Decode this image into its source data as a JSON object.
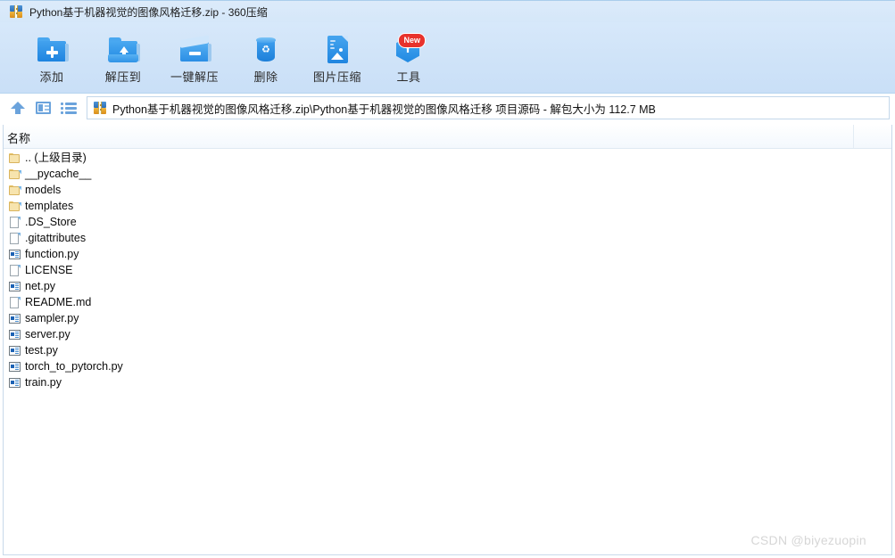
{
  "window": {
    "title": "Python基于机器视觉的图像风格迁移.zip - 360压缩",
    "app_icon": "zip-archive-icon"
  },
  "toolbar": {
    "buttons": [
      {
        "label": "添加",
        "icon": "folder-add-icon"
      },
      {
        "label": "解压到",
        "icon": "folder-extract-icon"
      },
      {
        "label": "一键解压",
        "icon": "folder-oneclick-extract-icon"
      },
      {
        "label": "删除",
        "icon": "recycle-bin-icon"
      },
      {
        "label": "图片压缩",
        "icon": "image-compress-icon"
      },
      {
        "label": "工具",
        "icon": "tools-hexagon-icon",
        "badge": "New"
      }
    ]
  },
  "addressbar": {
    "up_icon": "arrow-up-icon",
    "panel_icon": "preview-panel-icon",
    "list_icon": "list-view-icon",
    "path_icon": "zip-archive-icon",
    "path": "Python基于机器视觉的图像风格迁移.zip\\Python基于机器视觉的图像风格迁移 项目源码 - 解包大小为 112.7 MB"
  },
  "filelist": {
    "columns": [
      "名称"
    ],
    "rows": [
      {
        "name": ".. (上级目录)",
        "icon": "folder-plain-icon"
      },
      {
        "name": "__pycache__",
        "icon": "folder-icon"
      },
      {
        "name": "models",
        "icon": "folder-icon"
      },
      {
        "name": "templates",
        "icon": "folder-icon"
      },
      {
        "name": ".DS_Store",
        "icon": "file-icon"
      },
      {
        "name": ".gitattributes",
        "icon": "file-icon"
      },
      {
        "name": "function.py",
        "icon": "python-file-icon"
      },
      {
        "name": "LICENSE",
        "icon": "file-icon"
      },
      {
        "name": "net.py",
        "icon": "python-file-icon"
      },
      {
        "name": "README.md",
        "icon": "file-icon"
      },
      {
        "name": "sampler.py",
        "icon": "python-file-icon"
      },
      {
        "name": "server.py",
        "icon": "python-file-icon"
      },
      {
        "name": "test.py",
        "icon": "python-file-icon"
      },
      {
        "name": "torch_to_pytorch.py",
        "icon": "python-file-icon"
      },
      {
        "name": "train.py",
        "icon": "python-file-icon"
      }
    ]
  },
  "watermark": {
    "text": "CSDN @biyezuopin"
  },
  "colors": {
    "title_bg": "#dcebfa",
    "toolbar_bg": "#cfe3f8",
    "accent_blue": "#2189e2",
    "badge_red": "#e8322c",
    "folder_yellow": "#f7e4ae",
    "watermark_gray": "#d6d6d6"
  }
}
